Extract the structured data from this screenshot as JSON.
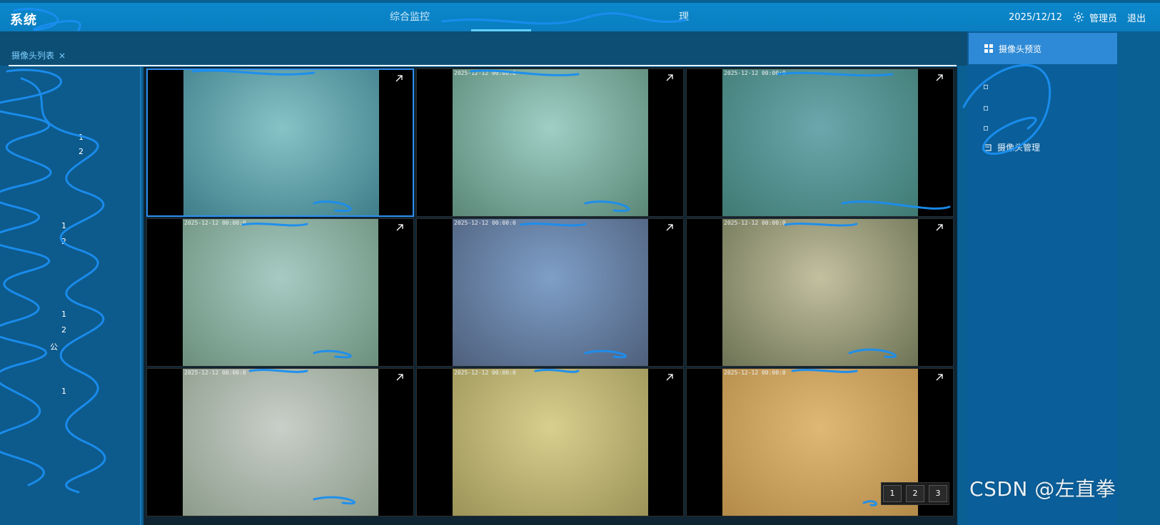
{
  "header": {
    "app_title": "系统",
    "nav": [
      {
        "label": "综合监控",
        "active": false
      },
      {
        "label": "",
        "active": true
      },
      {
        "label": "",
        "active": false
      },
      {
        "label": "理",
        "active": false
      }
    ],
    "date": "2025/12/12",
    "user": "管理员",
    "logout": "退出",
    "settings_icon": "gear-icon"
  },
  "tabs": [
    {
      "label": "摄像头列表",
      "close_icon": "close-icon"
    }
  ],
  "left_tree": {
    "items": [
      "",
      "",
      "1",
      "2",
      "",
      "",
      "1",
      "2",
      "1",
      "2",
      "公",
      "1",
      "",
      "",
      ""
    ]
  },
  "cameras": [
    {
      "timestamp": "",
      "colors": [
        "#86c3c7",
        "#3f7e8a"
      ],
      "selected": true
    },
    {
      "timestamp": "2025-12-12 00:00:0",
      "colors": [
        "#9fcfc5",
        "#5a8776"
      ],
      "selected": false
    },
    {
      "timestamp": "2025-12-12 00:00:0",
      "colors": [
        "#6ba7ad",
        "#3f7a73"
      ],
      "selected": false
    },
    {
      "timestamp": "2025-12-12 00:00:0",
      "colors": [
        "#a7cbc3",
        "#6c8f7c"
      ],
      "selected": false
    },
    {
      "timestamp": "2025-12-12 00:00:0",
      "colors": [
        "#7e9fc7",
        "#4e5f7c"
      ],
      "selected": false
    },
    {
      "timestamp": "2025-12-12 00:00:0",
      "colors": [
        "#c3c0a0",
        "#6c7354"
      ],
      "selected": false
    },
    {
      "timestamp": "2025-12-12 00:00:0",
      "colors": [
        "#c9cfc9",
        "#8b9b8a"
      ],
      "selected": false
    },
    {
      "timestamp": "2025-12-12 00:00:0",
      "colors": [
        "#d8cf8e",
        "#9b9357"
      ],
      "selected": false
    },
    {
      "timestamp": "2025-12-12 00:00:0",
      "colors": [
        "#e0b876",
        "#b38a48"
      ],
      "selected": false
    }
  ],
  "right_panel": {
    "active_label": "摄像头预览",
    "active_icon": "grid-icon",
    "items": [
      {
        "label": "",
        "icon": "camera-icon"
      },
      {
        "label": "",
        "icon": "camera-icon"
      },
      {
        "label": "",
        "icon": "camera-icon"
      },
      {
        "label": "摄像头管理",
        "icon": "settings-icon"
      }
    ]
  },
  "pagination": {
    "pages": [
      "1",
      "2",
      "3"
    ]
  },
  "watermark": "CSDN @左直拳",
  "colors": {
    "header": "#0a84c6",
    "accent": "#2e8ad6",
    "panel": "#0d5a8c"
  }
}
